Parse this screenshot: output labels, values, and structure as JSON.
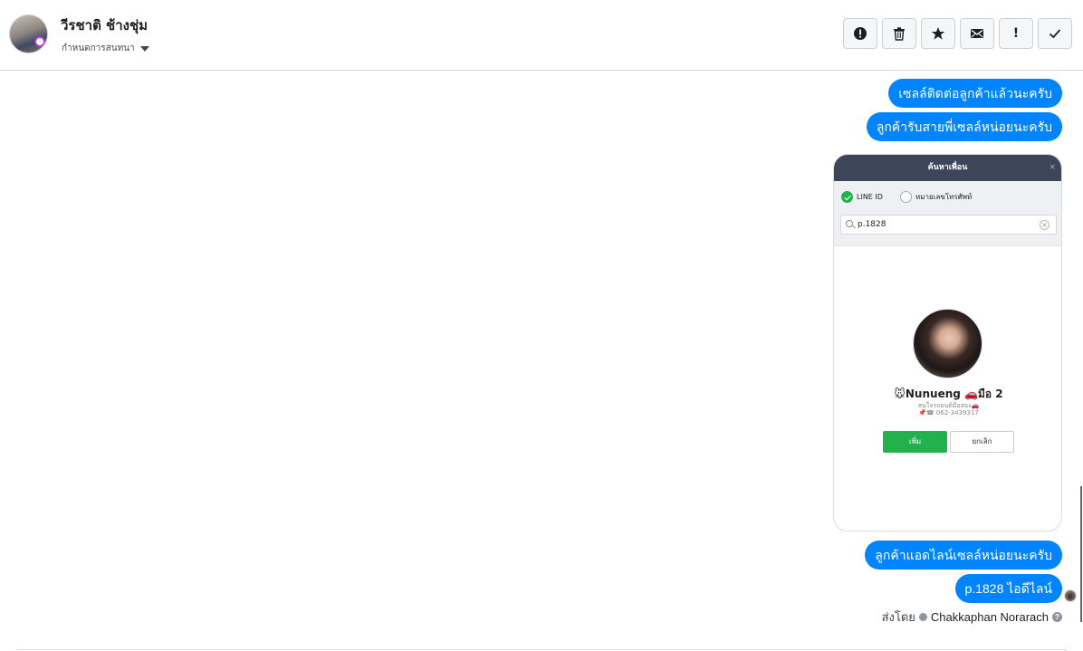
{
  "header": {
    "contact_name": "วีรชาติ ช้างชุ่ม",
    "assign_label": "กำหนดการสนทนา",
    "toolbar": [
      {
        "name": "spam-button",
        "icon": "alert-circle-icon"
      },
      {
        "name": "delete-button",
        "icon": "trash-icon"
      },
      {
        "name": "star-button",
        "icon": "star-icon"
      },
      {
        "name": "mark-unread-button",
        "icon": "envelope-icon"
      },
      {
        "name": "important-button",
        "icon": "exclamation-icon"
      },
      {
        "name": "done-button",
        "icon": "check-icon"
      }
    ]
  },
  "messages": [
    "เซลล์ติดต่อลูกค้าแล้วนะครับ",
    "ลูกค้ารับสายพี่เซลล์หน่อยนะครับ",
    "ลูกค้าแอดไลน์เซลล์หน่อยนะครับ",
    "p.1828 ไอดีไลน์"
  ],
  "screenshot": {
    "title": "ค้นหาเพื่อน",
    "close": "×",
    "radio_line_id": "LINE ID",
    "radio_phone": "หมายเลขโทรศัพท์",
    "search_value": "p.1828",
    "clear": "×",
    "profile_name": "🐭Nunueng 🚗มือ 2",
    "profile_line1": "สนใจรถยนต์มือสอง🚗",
    "profile_line2": "📌☎ 062-3439317",
    "add_label": "เพิ่ม",
    "cancel_label": "ยกเลิก"
  },
  "footer": {
    "sent_by_label": "ส่งโดย",
    "sender": "Chakkaphan Norarach",
    "help": "?"
  },
  "colors": {
    "bubble": "#0084ff",
    "line_green": "#22b14c",
    "line_header": "#3c4658"
  }
}
